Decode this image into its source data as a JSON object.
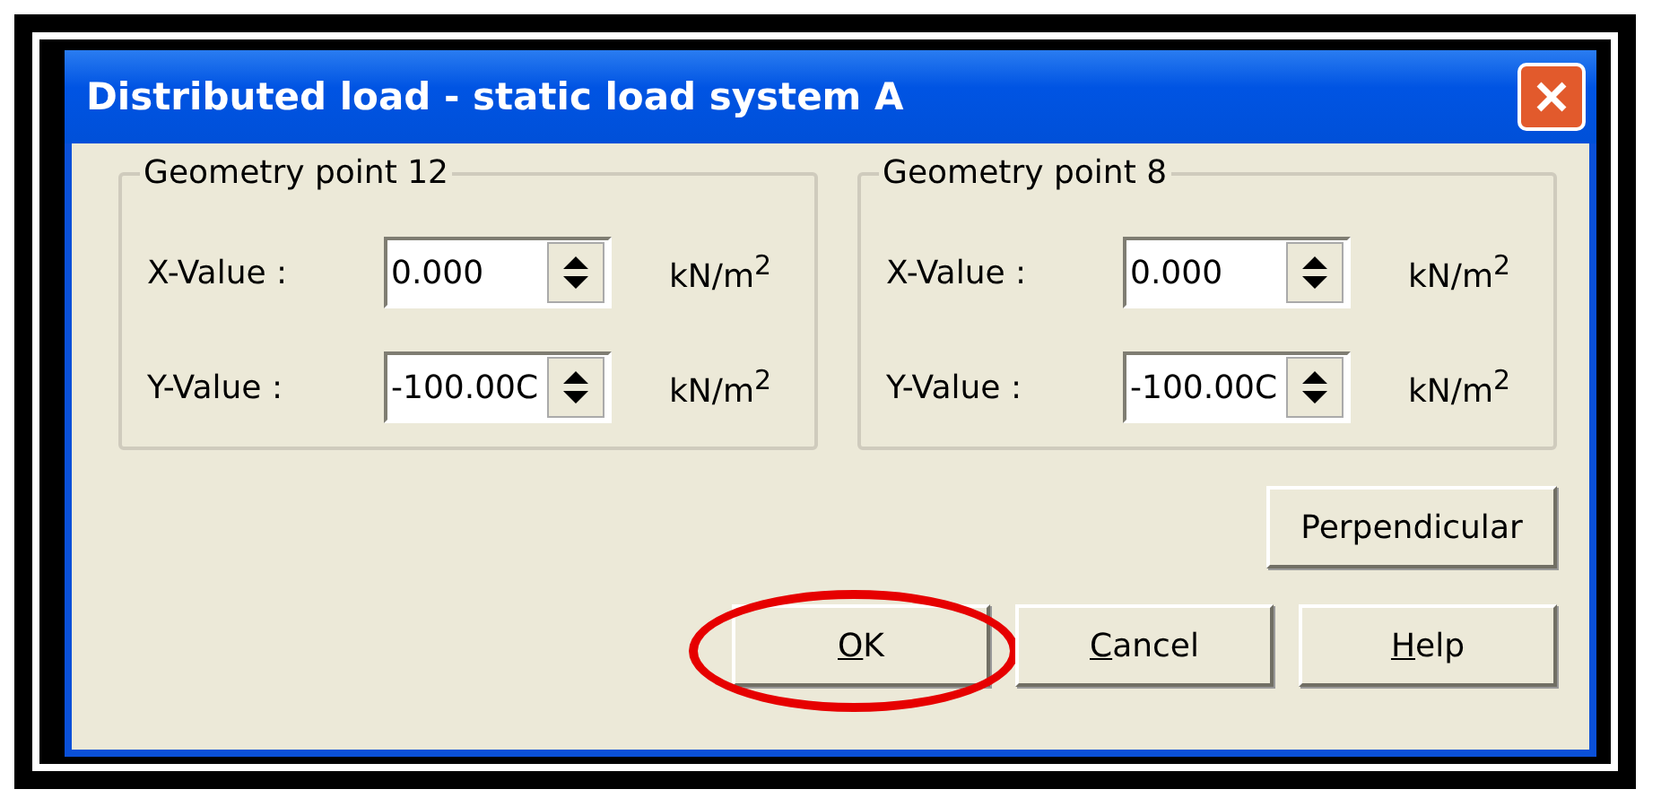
{
  "window": {
    "title": "Distributed load - static load system A"
  },
  "groups": [
    {
      "title": "Geometry point 12",
      "fields": [
        {
          "label": "X-Value :",
          "value": "0.000",
          "unit": "kN/m$^{2}$"
        },
        {
          "label": "Y-Value :",
          "value": "-100.00C",
          "unit": "kN/m$^{2}$"
        }
      ]
    },
    {
      "title": "Geometry point 8",
      "fields": [
        {
          "label": "X-Value :",
          "value": "0.000",
          "unit": "kN/m$^{2}$"
        },
        {
          "label": "Y-Value :",
          "value": "-100.00C",
          "unit": "kN/m$^{2}$"
        }
      ]
    }
  ],
  "perpendicular_button": {
    "label": "Perpendicular"
  },
  "buttons": [
    {
      "label": "OK",
      "mnemonic": true,
      "circled": true
    },
    {
      "label": "Cancel",
      "mnemonic": true,
      "circled": false
    },
    {
      "label": "Help",
      "mnemonic": true,
      "circled": false
    }
  ]
}
